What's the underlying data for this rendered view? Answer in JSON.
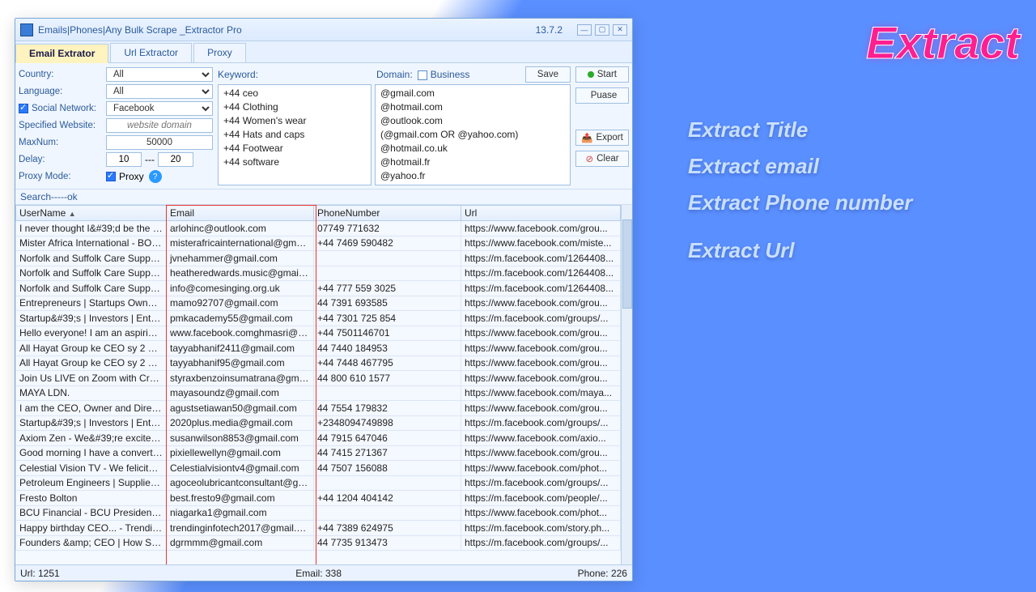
{
  "window": {
    "title": "Emails|Phones|Any Bulk Scrape _Extractor Pro",
    "version": "13.7.2"
  },
  "tabs": {
    "email": "Email Extrator",
    "url": "Url Extractor",
    "proxy": "Proxy"
  },
  "form": {
    "country_lbl": "Country:",
    "country_val": "All",
    "language_lbl": "Language:",
    "language_val": "All",
    "social_lbl": "Social Network:",
    "social_val": "Facebook",
    "website_lbl": "Specified Website:",
    "website_ph": "website domain",
    "maxnum_lbl": "MaxNum:",
    "maxnum_val": "50000",
    "delay_lbl": "Delay:",
    "delay_from": "10",
    "delay_sep": "---",
    "delay_to": "20",
    "proxymode_lbl": "Proxy Mode:",
    "proxymode_val": "Proxy"
  },
  "kwpanel": {
    "keyword_lbl": "Keyword:",
    "domain_lbl": "Domain:",
    "business_lbl": "Business",
    "save_lbl": "Save",
    "keywords": [
      "+44 ceo",
      "+44  Clothing",
      "+44 Women's wear",
      "+44  Hats and caps",
      "+44 Footwear",
      "+44 software"
    ],
    "domains": [
      "@gmail.com",
      "@hotmail.com",
      "@outlook.com",
      "(@gmail.com OR @yahoo.com)",
      "@hotmail.co.uk",
      "@hotmail.fr",
      "@yahoo.fr"
    ]
  },
  "buttons": {
    "start": "Start",
    "pause": "Puase",
    "export": "Export",
    "clear": "Clear"
  },
  "search_msg": "Search-----ok",
  "columns": {
    "user": "UserName",
    "email": "Email",
    "phone": "PhoneNumber",
    "url": "Url"
  },
  "rows": [
    {
      "u": "I never thought I&#39;d be the p...",
      "e": "arlohinc@outlook.com",
      "p": "07749 771632",
      "r": "https://www.facebook.com/grou..."
    },
    {
      "u": "Mister Africa International - BOTS...",
      "e": "misterafricainternational@gmail.c...",
      "p": "+44 7469 590482",
      "r": "https://www.facebook.com/miste..."
    },
    {
      "u": "Norfolk and Suffolk Care Support...",
      "e": "jvnehammer@gmail.com",
      "p": "",
      "r": "https://m.facebook.com/1264408..."
    },
    {
      "u": "Norfolk and Suffolk Care Support...",
      "e": "heatheredwards.music@gmail.com",
      "p": "",
      "r": "https://m.facebook.com/1264408..."
    },
    {
      "u": "Norfolk and Suffolk Care Support...",
      "e": "info@comesinging.org.uk",
      "p": "+44 777 559 3025",
      "r": "https://m.facebook.com/1264408..."
    },
    {
      "u": "Entrepreneurs | Startups Owners | ...",
      "e": "mamo92707@gmail.com",
      "p": "44 7391 693585",
      "r": "https://www.facebook.com/grou..."
    },
    {
      "u": "Startup&#39;s | Investors | Entrep...",
      "e": "pmkacademy55@gmail.com",
      "p": "+44 7301 725 854",
      "r": "https://m.facebook.com/groups/..."
    },
    {
      "u": "Hello everyone! I am an aspiring s...",
      "e": "www.facebook.comghmasri@gm...",
      "p": "+44 7501146701",
      "r": "https://www.facebook.com/grou..."
    },
    {
      "u": "All Hayat Group ke CEO sy 2 Dire...",
      "e": "tayyabhanif2411@gmail.com",
      "p": "44 7440 184953",
      "r": "https://www.facebook.com/grou..."
    },
    {
      "u": "All Hayat Group ke CEO sy 2 Dire...",
      "e": "tayyabhanif95@gmail.com",
      "p": "+44 7448 467795",
      "r": "https://www.facebook.com/grou..."
    },
    {
      "u": "Join Us LIVE on Zoom with Crown...",
      "e": "styraxbenzoinsumatrana@gmail.c...",
      "p": "44 800 610 1577",
      "r": "https://www.facebook.com/grou..."
    },
    {
      "u": "MAYA LDN.",
      "e": "mayasoundz@gmail.com",
      "p": "",
      "r": "https://www.facebook.com/maya..."
    },
    {
      "u": "I am the CEO, Owner and Direct F...",
      "e": "agustsetiawan50@gmail.com",
      "p": "44 7554 179832",
      "r": "https://www.facebook.com/grou..."
    },
    {
      "u": "Startup&#39;s | Investors | Entrep...",
      "e": "2020plus.media@gmail.com",
      "p": "+2348094749898",
      "r": "https://m.facebook.com/groups/..."
    },
    {
      "u": "Axiom Zen - We&#39;re excited t...",
      "e": "susanwilson8853@gmail.com",
      "p": "44 7915 647046",
      "r": "https://www.facebook.com/axio..."
    },
    {
      "u": "Good morning I have a converted...",
      "e": "pixiellewellyn@gmail.com",
      "p": "44 7415 271367",
      "r": "https://www.facebook.com/grou..."
    },
    {
      "u": "Celestial Vision TV - We felicitate ...",
      "e": "Celestialvisiontv4@gmail.com",
      "p": "44 7507 156088",
      "r": "https://www.facebook.com/phot..."
    },
    {
      "u": "Petroleum Engineers | Supplier ne...",
      "e": "agoceolubricantconsultant@gmai...",
      "p": "",
      "r": "https://m.facebook.com/groups/..."
    },
    {
      "u": "Fresto Bolton",
      "e": "best.fresto9@gmail.com",
      "p": "+44 1204 404142",
      "r": "https://m.facebook.com/people/..."
    },
    {
      "u": "BCU Financial - BCU President &a...",
      "e": "niagarka1@gmail.com",
      "p": "",
      "r": "https://www.facebook.com/phot..."
    },
    {
      "u": "Happy birthday CEO... - Trending ...",
      "e": "trendinginfotech2017@gmail.com",
      "p": "+44 7389 624975",
      "r": "https://m.facebook.com/story.ph..."
    },
    {
      "u": "Founders &amp; CEO | How Start...",
      "e": "dgrmmm@gmail.com",
      "p": "44 7735 913473",
      "r": "https://m.facebook.com/groups/..."
    }
  ],
  "status": {
    "url": "Url:  1251",
    "email": "Email:  338",
    "phone": "Phone:  226"
  },
  "promo": {
    "title": "Extract",
    "l1": "Extract Title",
    "l2": "Extract email",
    "l3": "Extract Phone number",
    "l4": "Extract Url"
  }
}
